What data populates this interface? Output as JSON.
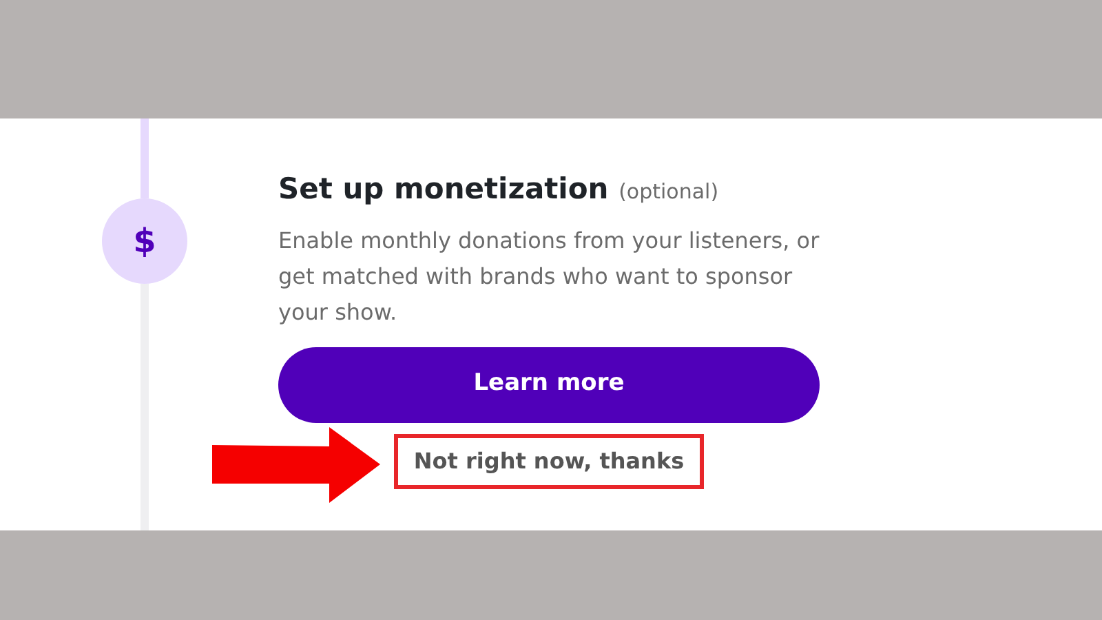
{
  "step": {
    "icon_text": "$",
    "line_before_done": true
  },
  "title": "Set up monetization",
  "title_note": "(optional)",
  "description": "Enable monthly donations from your listeners, or get matched with brands who want to sponsor your show.",
  "primary_button": {
    "label": "Learn more"
  },
  "secondary_link": {
    "label": "Not right now, thanks",
    "highlighted": true
  }
}
